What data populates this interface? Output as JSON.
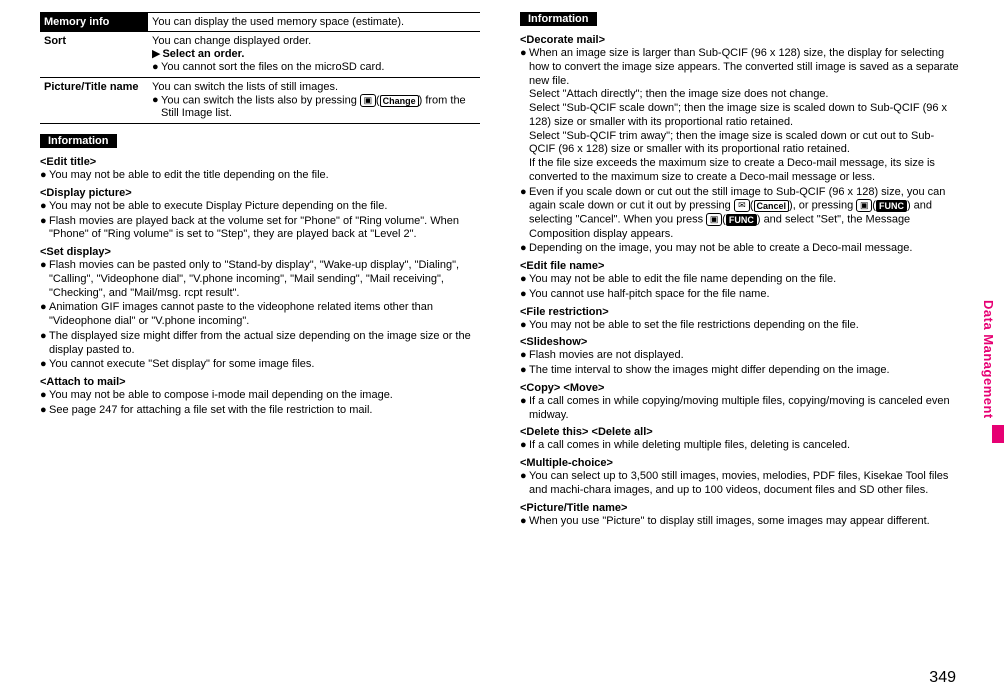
{
  "table": {
    "rows": [
      {
        "label": "Memory info",
        "dark": true,
        "lines": [
          "You can display the used memory space (estimate)."
        ]
      },
      {
        "label": "Sort",
        "dark": false,
        "lines": [
          "You can change displayed order.",
          "▶Select an order.",
          "●You cannot sort the files on the microSD card."
        ]
      },
      {
        "label": "Picture/Title name",
        "dark": false,
        "lines": [
          "You can switch the lists of still images.",
          "●You can switch the lists also by pressing 📷(Change) from the Still Image list."
        ]
      }
    ]
  },
  "left": {
    "header": "Information",
    "sections": [
      {
        "title": "<Edit title>",
        "bullets": [
          "You may not be able to edit the title depending on the file."
        ]
      },
      {
        "title": "<Display picture>",
        "bullets": [
          "You may not be able to execute Display Picture depending on the file.",
          "Flash movies are played back at the volume set for \"Phone\" of \"Ring volume\". When \"Phone\" of \"Ring volume\" is set to \"Step\", they are played back at \"Level 2\"."
        ]
      },
      {
        "title": "<Set display>",
        "bullets": [
          "Flash movies can be pasted only to \"Stand-by display\", \"Wake-up display\", \"Dialing\", \"Calling\", \"Videophone dial\", \"V.phone incoming\", \"Mail sending\", \"Mail receiving\", \"Checking\", and \"Mail/msg. rcpt result\".",
          "Animation GIF images cannot paste to the videophone related items other than \"Videophone dial\" or \"V.phone incoming\".",
          "The displayed size might differ from the actual size depending on the image size or the display pasted to.",
          "You cannot execute \"Set display\" for some image files."
        ]
      },
      {
        "title": "<Attach to mail>",
        "bullets": [
          "You may not be able to compose i-mode mail depending on the image.",
          "See page 247 for attaching a file set with the file restriction to mail."
        ]
      }
    ]
  },
  "right": {
    "header": "Information",
    "sections": [
      {
        "title": "<Decorate mail>",
        "bullets": [
          "When an image size is larger than Sub-QCIF (96 x 128) size, the display for selecting how to convert the image size appears. The converted still image is saved as a separate new file.\nSelect \"Attach directly\"; then the image size does not change.\nSelect \"Sub-QCIF scale down\"; then the image size is scaled down to Sub-QCIF (96 x 128) size or smaller with its proportional ratio retained.\nSelect \"Sub-QCIF trim away\"; then the image size is scaled down or cut out to Sub-QCIF (96 x 128) size or smaller with its proportional ratio retained.\nIf the file size exceeds the maximum size to create a Deco-mail message, its size is converted to the maximum size to create a Deco-mail message or less.",
          "Even if you scale down or cut out the still image to Sub-QCIF (96 x 128) size, you can again scale down or cut it out by pressing ✉(Cancel), or pressing 📷(FUNC) and selecting \"Cancel\". When you press 📷(FUNC) and select \"Set\", the Message Composition display appears.",
          "Depending on the image, you may not be able to create a Deco-mail message."
        ]
      },
      {
        "title": "<Edit file name>",
        "bullets": [
          "You may not be able to edit the file name depending on the file.",
          "You cannot use half-pitch space for the file name."
        ]
      },
      {
        "title": "<File restriction>",
        "bullets": [
          "You may not be able to set the file restrictions depending on the file."
        ]
      },
      {
        "title": "<Slideshow>",
        "bullets": [
          "Flash movies are not displayed.",
          "The time interval to show the images might differ depending on the image."
        ]
      },
      {
        "title": "<Copy> <Move>",
        "bullets": [
          "If a call comes in while copying/moving multiple files, copying/moving is canceled even midway."
        ]
      },
      {
        "title": "<Delete this> <Delete all>",
        "bullets": [
          "If a call comes in while deleting multiple files, deleting is canceled."
        ]
      },
      {
        "title": "<Multiple-choice>",
        "bullets": [
          "You can select up to 3,500 still images, movies, melodies, PDF files, Kisekae Tool files and machi-chara images, and up to 100 videos, document files and SD other files."
        ]
      },
      {
        "title": "<Picture/Title name>",
        "bullets": [
          "When you use \"Picture\" to display still images, some images may appear different."
        ]
      }
    ]
  },
  "sideTab": "Data Management",
  "pageNumber": "349"
}
